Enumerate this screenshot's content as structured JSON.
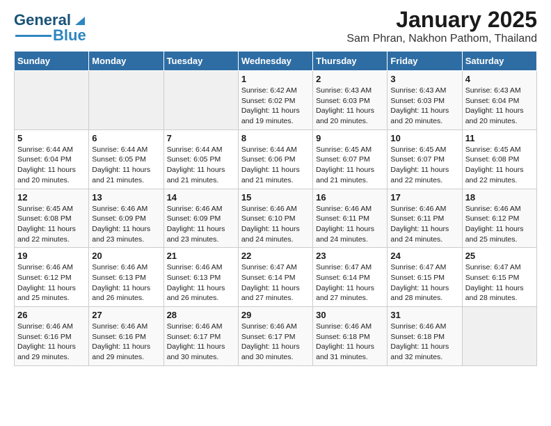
{
  "header": {
    "logo": {
      "line1": "General",
      "line2": "Blue"
    },
    "title": "January 2025",
    "subtitle": "Sam Phran, Nakhon Pathom, Thailand"
  },
  "weekdays": [
    "Sunday",
    "Monday",
    "Tuesday",
    "Wednesday",
    "Thursday",
    "Friday",
    "Saturday"
  ],
  "weeks": [
    [
      {
        "day": "",
        "info": ""
      },
      {
        "day": "",
        "info": ""
      },
      {
        "day": "",
        "info": ""
      },
      {
        "day": "1",
        "info": "Sunrise: 6:42 AM\nSunset: 6:02 PM\nDaylight: 11 hours\nand 19 minutes."
      },
      {
        "day": "2",
        "info": "Sunrise: 6:43 AM\nSunset: 6:03 PM\nDaylight: 11 hours\nand 20 minutes."
      },
      {
        "day": "3",
        "info": "Sunrise: 6:43 AM\nSunset: 6:03 PM\nDaylight: 11 hours\nand 20 minutes."
      },
      {
        "day": "4",
        "info": "Sunrise: 6:43 AM\nSunset: 6:04 PM\nDaylight: 11 hours\nand 20 minutes."
      }
    ],
    [
      {
        "day": "5",
        "info": "Sunrise: 6:44 AM\nSunset: 6:04 PM\nDaylight: 11 hours\nand 20 minutes."
      },
      {
        "day": "6",
        "info": "Sunrise: 6:44 AM\nSunset: 6:05 PM\nDaylight: 11 hours\nand 21 minutes."
      },
      {
        "day": "7",
        "info": "Sunrise: 6:44 AM\nSunset: 6:05 PM\nDaylight: 11 hours\nand 21 minutes."
      },
      {
        "day": "8",
        "info": "Sunrise: 6:44 AM\nSunset: 6:06 PM\nDaylight: 11 hours\nand 21 minutes."
      },
      {
        "day": "9",
        "info": "Sunrise: 6:45 AM\nSunset: 6:07 PM\nDaylight: 11 hours\nand 21 minutes."
      },
      {
        "day": "10",
        "info": "Sunrise: 6:45 AM\nSunset: 6:07 PM\nDaylight: 11 hours\nand 22 minutes."
      },
      {
        "day": "11",
        "info": "Sunrise: 6:45 AM\nSunset: 6:08 PM\nDaylight: 11 hours\nand 22 minutes."
      }
    ],
    [
      {
        "day": "12",
        "info": "Sunrise: 6:45 AM\nSunset: 6:08 PM\nDaylight: 11 hours\nand 22 minutes."
      },
      {
        "day": "13",
        "info": "Sunrise: 6:46 AM\nSunset: 6:09 PM\nDaylight: 11 hours\nand 23 minutes."
      },
      {
        "day": "14",
        "info": "Sunrise: 6:46 AM\nSunset: 6:09 PM\nDaylight: 11 hours\nand 23 minutes."
      },
      {
        "day": "15",
        "info": "Sunrise: 6:46 AM\nSunset: 6:10 PM\nDaylight: 11 hours\nand 24 minutes."
      },
      {
        "day": "16",
        "info": "Sunrise: 6:46 AM\nSunset: 6:11 PM\nDaylight: 11 hours\nand 24 minutes."
      },
      {
        "day": "17",
        "info": "Sunrise: 6:46 AM\nSunset: 6:11 PM\nDaylight: 11 hours\nand 24 minutes."
      },
      {
        "day": "18",
        "info": "Sunrise: 6:46 AM\nSunset: 6:12 PM\nDaylight: 11 hours\nand 25 minutes."
      }
    ],
    [
      {
        "day": "19",
        "info": "Sunrise: 6:46 AM\nSunset: 6:12 PM\nDaylight: 11 hours\nand 25 minutes."
      },
      {
        "day": "20",
        "info": "Sunrise: 6:46 AM\nSunset: 6:13 PM\nDaylight: 11 hours\nand 26 minutes."
      },
      {
        "day": "21",
        "info": "Sunrise: 6:46 AM\nSunset: 6:13 PM\nDaylight: 11 hours\nand 26 minutes."
      },
      {
        "day": "22",
        "info": "Sunrise: 6:47 AM\nSunset: 6:14 PM\nDaylight: 11 hours\nand 27 minutes."
      },
      {
        "day": "23",
        "info": "Sunrise: 6:47 AM\nSunset: 6:14 PM\nDaylight: 11 hours\nand 27 minutes."
      },
      {
        "day": "24",
        "info": "Sunrise: 6:47 AM\nSunset: 6:15 PM\nDaylight: 11 hours\nand 28 minutes."
      },
      {
        "day": "25",
        "info": "Sunrise: 6:47 AM\nSunset: 6:15 PM\nDaylight: 11 hours\nand 28 minutes."
      }
    ],
    [
      {
        "day": "26",
        "info": "Sunrise: 6:46 AM\nSunset: 6:16 PM\nDaylight: 11 hours\nand 29 minutes."
      },
      {
        "day": "27",
        "info": "Sunrise: 6:46 AM\nSunset: 6:16 PM\nDaylight: 11 hours\nand 29 minutes."
      },
      {
        "day": "28",
        "info": "Sunrise: 6:46 AM\nSunset: 6:17 PM\nDaylight: 11 hours\nand 30 minutes."
      },
      {
        "day": "29",
        "info": "Sunrise: 6:46 AM\nSunset: 6:17 PM\nDaylight: 11 hours\nand 30 minutes."
      },
      {
        "day": "30",
        "info": "Sunrise: 6:46 AM\nSunset: 6:18 PM\nDaylight: 11 hours\nand 31 minutes."
      },
      {
        "day": "31",
        "info": "Sunrise: 6:46 AM\nSunset: 6:18 PM\nDaylight: 11 hours\nand 32 minutes."
      },
      {
        "day": "",
        "info": ""
      }
    ]
  ]
}
